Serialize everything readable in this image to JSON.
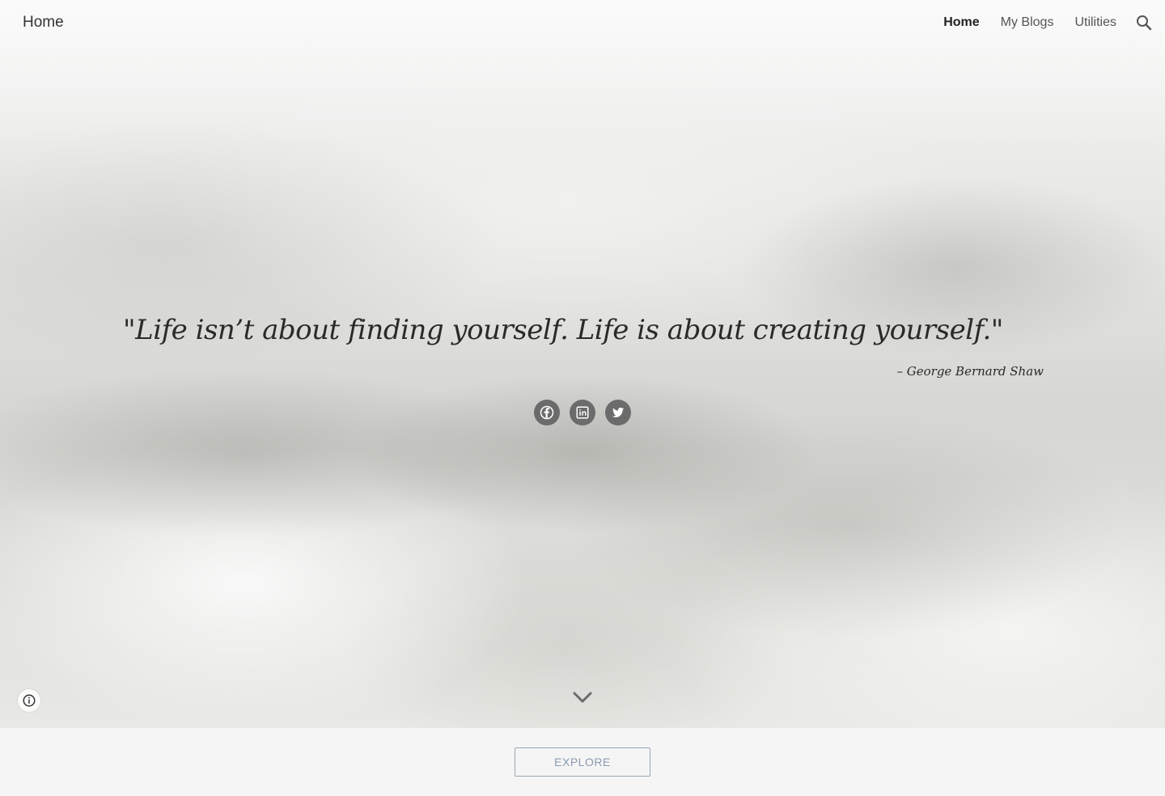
{
  "header": {
    "site_title": "Home",
    "nav": [
      {
        "label": "Home",
        "active": true
      },
      {
        "label": "My Blogs",
        "active": false
      },
      {
        "label": "Utilities",
        "active": false
      }
    ],
    "search_icon": "search-icon"
  },
  "hero": {
    "quote": "\"Life isn’t about finding yourself. Life is about creating yourself.\"",
    "attribution": "– George Bernard Shaw",
    "social": [
      {
        "name": "facebook-icon"
      },
      {
        "name": "linkedin-icon"
      },
      {
        "name": "twitter-icon"
      }
    ]
  },
  "footer": {
    "explore_label": "EXPLORE"
  },
  "colors": {
    "nav_text": "#555555",
    "nav_active": "#222222",
    "social_bg": "#6b6b6b",
    "explore_border": "#9aa7b6",
    "explore_text": "#8a9bb0"
  }
}
